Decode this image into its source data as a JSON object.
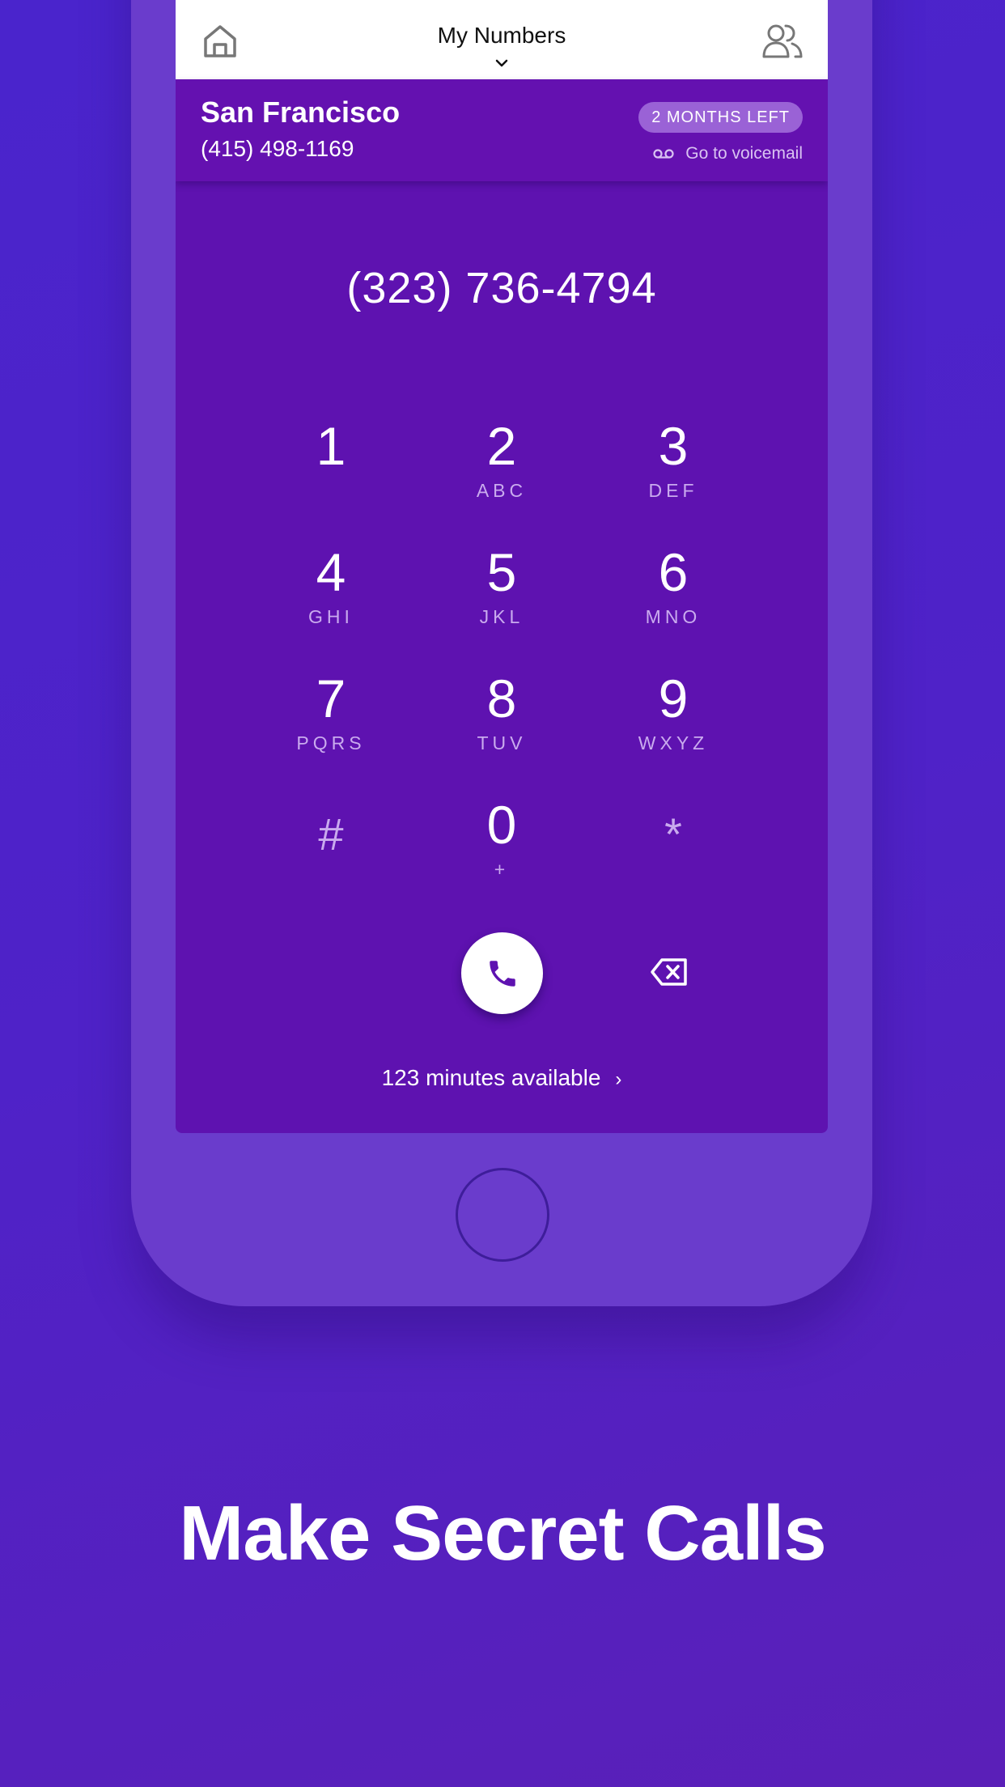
{
  "header": {
    "title": "My Numbers",
    "home_icon": "home-icon",
    "contacts_icon": "people-icon"
  },
  "number_bar": {
    "city": "San Francisco",
    "phone": "(415) 498-1169",
    "badge": "2 MONTHS LEFT",
    "voicemail_label": "Go to voicemail"
  },
  "dialer": {
    "dialed_number": "(323) 736-4794",
    "keys": [
      {
        "digit": "1",
        "letters": ""
      },
      {
        "digit": "2",
        "letters": "ABC"
      },
      {
        "digit": "3",
        "letters": "DEF"
      },
      {
        "digit": "4",
        "letters": "GHI"
      },
      {
        "digit": "5",
        "letters": "JKL"
      },
      {
        "digit": "6",
        "letters": "MNO"
      },
      {
        "digit": "7",
        "letters": "PQRS"
      },
      {
        "digit": "8",
        "letters": "TUV"
      },
      {
        "digit": "9",
        "letters": "WXYZ"
      },
      {
        "digit": "#",
        "letters": ""
      },
      {
        "digit": "0",
        "letters": "+"
      },
      {
        "digit": "*",
        "letters": ""
      }
    ],
    "minutes_label": "123 minutes available",
    "minutes_arrow": "›"
  },
  "headline": "Make Secret Calls",
  "colors": {
    "accent": "#5e12b0",
    "background": "#4f22c8",
    "badge": "#9a62d6"
  }
}
